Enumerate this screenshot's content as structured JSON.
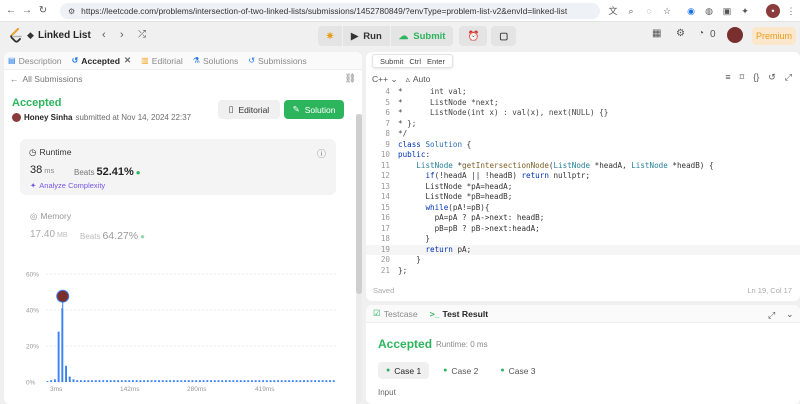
{
  "browser": {
    "url": "https://leetcode.com/problems/intersection-of-two-linked-lists/submissions/1452780849/?envType=problem-list-v2&envId=linked-list"
  },
  "topbar": {
    "problem_list": "Linked List",
    "run_label": "Run",
    "submit_label": "Submit",
    "points": "0",
    "premium": "Premium"
  },
  "left_tabs": [
    {
      "label": "Description",
      "icon": "description-icon"
    },
    {
      "label": "Accepted",
      "icon": "history-icon"
    },
    {
      "label": "Editorial",
      "icon": "book-icon"
    },
    {
      "label": "Solutions",
      "icon": "flask-icon"
    },
    {
      "label": "Submissions",
      "icon": "history-icon"
    }
  ],
  "submission": {
    "back_label": "All Submissions",
    "status": "Accepted",
    "user": "Honey Sinha",
    "submitted_text": "submitted at Nov 14, 2024 22:37",
    "editorial_btn": "Editorial",
    "solution_btn": "Solution"
  },
  "runtime": {
    "label": "Runtime",
    "value": "38",
    "unit": "ms",
    "beats_label": "Beats",
    "beats_value": "52.41%",
    "analyze": "Analyze Complexity"
  },
  "memory": {
    "label": "Memory",
    "value": "17.40",
    "unit": "MB",
    "beats_label": "Beats",
    "beats_value": "64.27%"
  },
  "chart_data": {
    "type": "bar",
    "yticks": [
      "0%",
      "20%",
      "40%",
      "60%"
    ],
    "ylim": [
      0,
      60
    ],
    "xticks": [
      "3ms",
      "142ms",
      "280ms",
      "419ms"
    ],
    "values": [
      0.5,
      1,
      1.5,
      28,
      41,
      9,
      3,
      1.5,
      1,
      1,
      1,
      1,
      1,
      1,
      1,
      1,
      1,
      1,
      1,
      1,
      1,
      1,
      1,
      1,
      1,
      1,
      1,
      1,
      1,
      1,
      1,
      1,
      1,
      1,
      1,
      1,
      1,
      1,
      1,
      1,
      1,
      1,
      1,
      1,
      1,
      1,
      1,
      1,
      1,
      1,
      1,
      1,
      1,
      1,
      1,
      1,
      1,
      1,
      1,
      1,
      1,
      1,
      1,
      1,
      1,
      1,
      1,
      1,
      1,
      1,
      1,
      1,
      1,
      1,
      1,
      1,
      1,
      1
    ],
    "highlight_index": 4,
    "grid": true,
    "color": "#3b82f6",
    "title": "",
    "xlabel": "",
    "ylabel": ""
  },
  "editor": {
    "tooltip": [
      "Submit",
      "Ctrl",
      "Enter"
    ],
    "language": "C++",
    "mode": "Auto",
    "saved": "Saved",
    "position": "Ln 19, Col 17",
    "lines": [
      {
        "n": "4",
        "html": "<span class=\"cm\">*      int val;</span>"
      },
      {
        "n": "5",
        "html": "<span class=\"cm\">*      ListNode *next;</span>"
      },
      {
        "n": "6",
        "html": "<span class=\"cm\">*      ListNode(int x) : val(x), next(NULL) {}</span>"
      },
      {
        "n": "7",
        "html": "<span class=\"cm\">* };</span>"
      },
      {
        "n": "8",
        "html": "<span class=\"cm\">*/</span>"
      },
      {
        "n": "9",
        "html": "<span class=\"kw\">class</span> <span class=\"cl\">Solution</span> {"
      },
      {
        "n": "10",
        "html": "<span class=\"kw\">public</span>:"
      },
      {
        "n": "11",
        "html": "    <span class=\"ty\">ListNode</span> *<span class=\"fn\">getIntersectionNode</span>(<span class=\"ty\">ListNode</span> *headA, <span class=\"ty\">ListNode</span> *headB) {"
      },
      {
        "n": "12",
        "html": "      <span class=\"kw\">if</span>(!headA || !headB) <span class=\"kw\">return</span> nullptr;"
      },
      {
        "n": "13",
        "html": "      ListNode *pA=headA;"
      },
      {
        "n": "14",
        "html": "      ListNode *pB=headB;"
      },
      {
        "n": "15",
        "html": "      <span class=\"kw\">while</span>(pA!=pB){"
      },
      {
        "n": "16",
        "html": "        pA=pA ? pA-&gt;next: headB;"
      },
      {
        "n": "17",
        "html": "        pB=pB ? pB-&gt;next:headA;"
      },
      {
        "n": "18",
        "html": "      }"
      },
      {
        "n": "19",
        "html": "      <span class=\"kw\">return</span> pA;"
      },
      {
        "n": "20",
        "html": "    }"
      },
      {
        "n": "21",
        "html": "};"
      }
    ]
  },
  "bottom": {
    "tabs": [
      {
        "label": "Testcase"
      },
      {
        "label": "Test Result"
      }
    ],
    "status": "Accepted",
    "runtime_text": "Runtime: 0 ms",
    "cases": [
      "Case 1",
      "Case 2",
      "Case 3"
    ],
    "input_label": "Input"
  }
}
